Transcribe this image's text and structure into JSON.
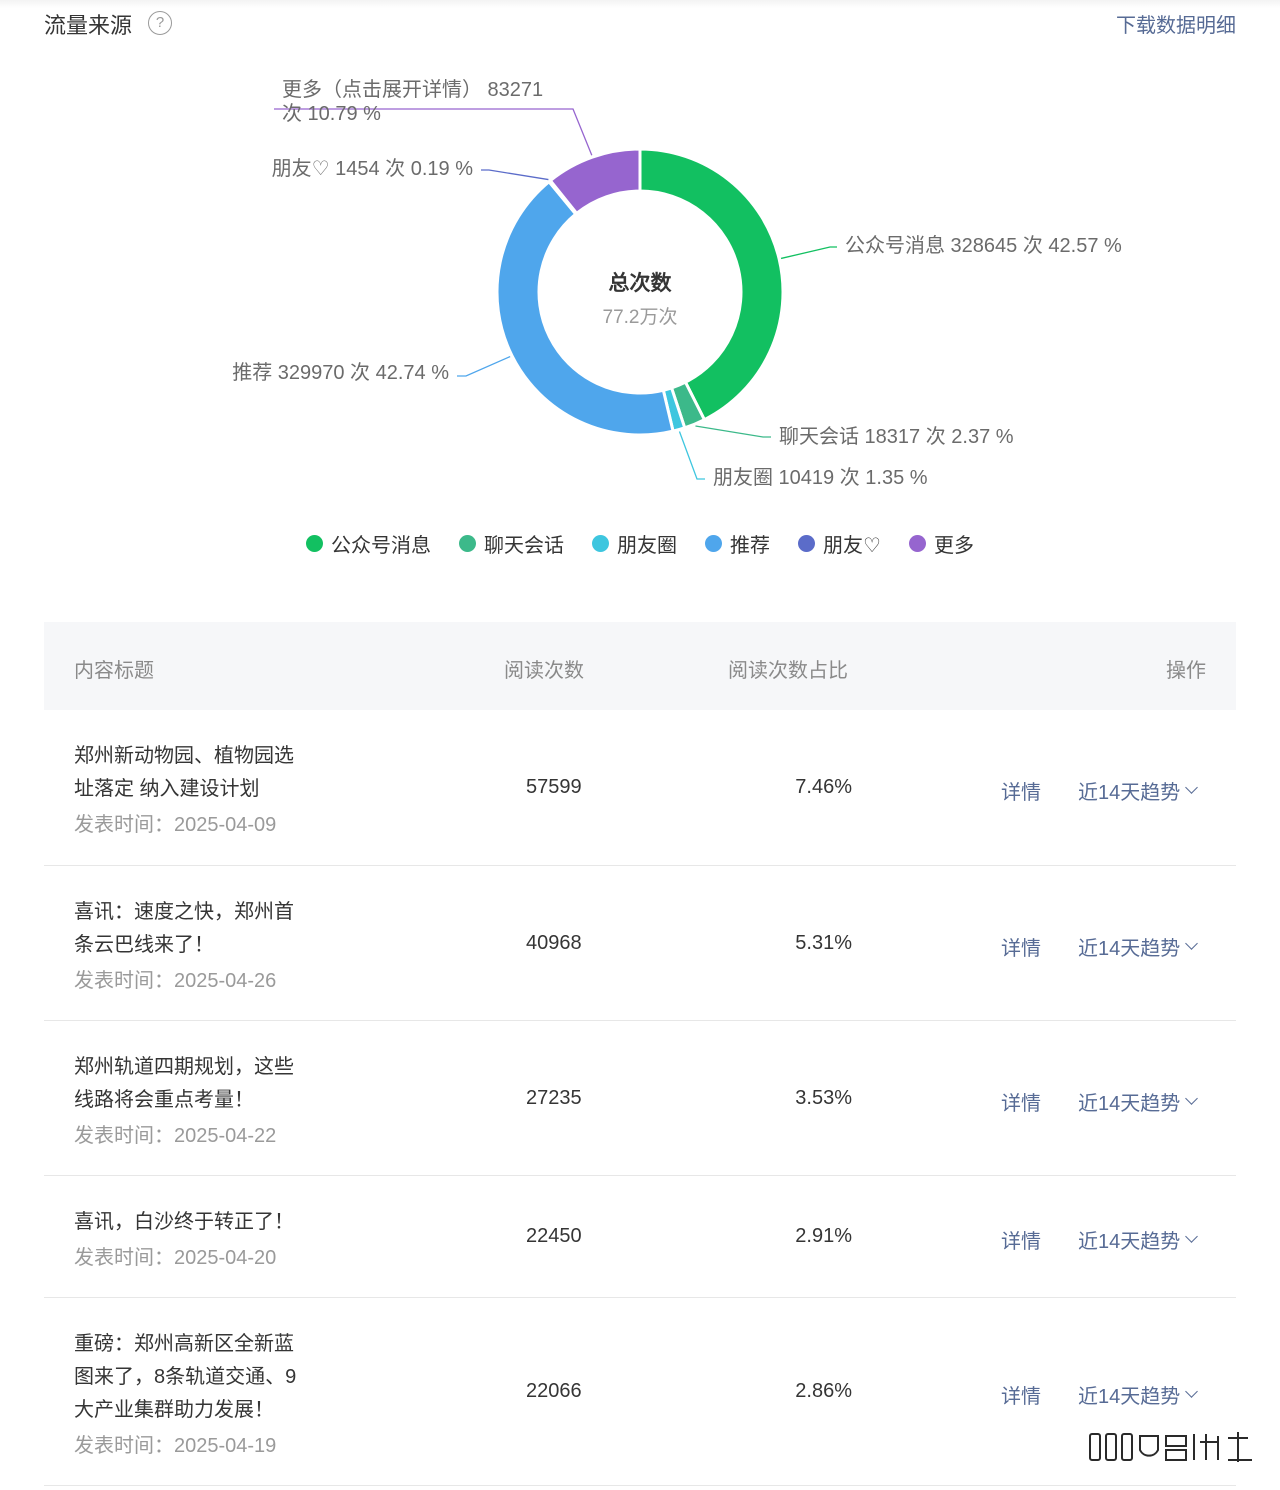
{
  "header": {
    "title": "流量来源",
    "help_glyph": "?",
    "download_label": "下载数据明细"
  },
  "chart_data": {
    "type": "pie",
    "center_title": "总次数",
    "center_value": "77.2万次",
    "slices": [
      {
        "name": "公众号消息",
        "count": 328645,
        "percent": 42.57,
        "label": "公众号消息 328645 次 42.57 %",
        "color": "#12c061"
      },
      {
        "name": "聊天会话",
        "count": 18317,
        "percent": 2.37,
        "label": "聊天会话 18317 次 2.37 %",
        "color": "#3cb98a"
      },
      {
        "name": "朋友圈",
        "count": 10419,
        "percent": 1.35,
        "label": "朋友圈 10419 次 1.35 %",
        "color": "#3ec6df"
      },
      {
        "name": "推荐",
        "count": 329970,
        "percent": 42.74,
        "label": "推荐 329970 次 42.74 %",
        "color": "#4fa6ec"
      },
      {
        "name": "朋友♡",
        "count": 1454,
        "percent": 0.19,
        "label": "朋友♡ 1454 次 0.19 %",
        "color": "#5b6cc9"
      },
      {
        "name": "更多",
        "count": 83271,
        "percent": 10.79,
        "label_lines": [
          "更多（点击展开详情） 83271",
          "次 10.79 %"
        ],
        "color": "#9665cf"
      }
    ]
  },
  "legend": [
    {
      "label": "公众号消息",
      "color": "#12c061"
    },
    {
      "label": "聊天会话",
      "color": "#3cb98a"
    },
    {
      "label": "朋友圈",
      "color": "#3ec6df"
    },
    {
      "label": "推荐",
      "color": "#4fa6ec"
    },
    {
      "label": "朋友♡",
      "color": "#5b6cc9"
    },
    {
      "label": "更多",
      "color": "#9665cf"
    }
  ],
  "table": {
    "headers": {
      "title": "内容标题",
      "reads": "阅读次数",
      "ratio": "阅读次数占比",
      "op": "操作"
    },
    "rows": [
      {
        "title_lines": [
          "郑州新动物园、植物园选",
          "址落定 纳入建设计划"
        ],
        "date": "发表时间：2025-04-09",
        "reads": "57599",
        "ratio": "7.46%",
        "detail": "详情",
        "trend": "近14天趋势"
      },
      {
        "title_lines": [
          "喜讯：速度之快，郑州首",
          "条云巴线来了！"
        ],
        "date": "发表时间：2025-04-26",
        "reads": "40968",
        "ratio": "5.31%",
        "detail": "详情",
        "trend": "近14天趋势"
      },
      {
        "title_lines": [
          "郑州轨道四期规划，这些",
          "线路将会重点考量！"
        ],
        "date": "发表时间：2025-04-22",
        "reads": "27235",
        "ratio": "3.53%",
        "detail": "详情",
        "trend": "近14天趋势"
      },
      {
        "title_lines": [
          "喜讯，白沙终于转正了！"
        ],
        "date": "发表时间：2025-04-20",
        "reads": "22450",
        "ratio": "2.91%",
        "detail": "详情",
        "trend": "近14天趋势"
      },
      {
        "title_lines": [
          "重磅：郑州高新区全新蓝",
          "图来了，8条轨道交通、9",
          "大产业集群助力发展！"
        ],
        "date": "发表时间：2025-04-19",
        "reads": "22066",
        "ratio": "2.86%",
        "detail": "详情",
        "trend": "近14天趋势"
      }
    ]
  }
}
